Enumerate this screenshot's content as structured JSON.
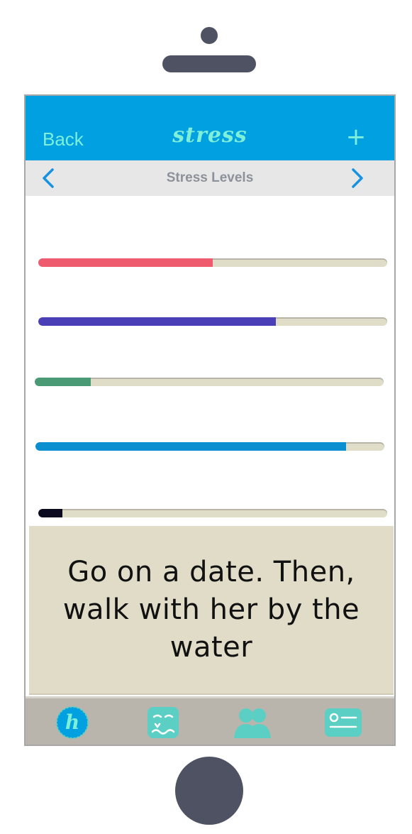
{
  "header": {
    "back_label": "Back",
    "title": "stress",
    "add_label": "+"
  },
  "subheader": {
    "title": "Stress Levels"
  },
  "bars": [
    {
      "level": 0.5,
      "color": "#ee5a6e"
    },
    {
      "level": 0.68,
      "color": "#4b3fb8"
    },
    {
      "level": 0.16,
      "color": "#4a9a76"
    },
    {
      "level": 0.89,
      "color": "#0a8fd0"
    },
    {
      "level": 0.07,
      "color": "#0b0a1f"
    }
  ],
  "message": {
    "text": "Go on a date. Then, walk with her by the water"
  },
  "tabbar": {
    "home_letter": "h",
    "icons": [
      "home-icon",
      "mood-face-icon",
      "friends-icon",
      "profile-card-icon"
    ]
  },
  "colors": {
    "accent": "#00a0e1",
    "mint": "#7ff0d8",
    "teal": "#5ccfc4",
    "device": "#4e5262"
  }
}
